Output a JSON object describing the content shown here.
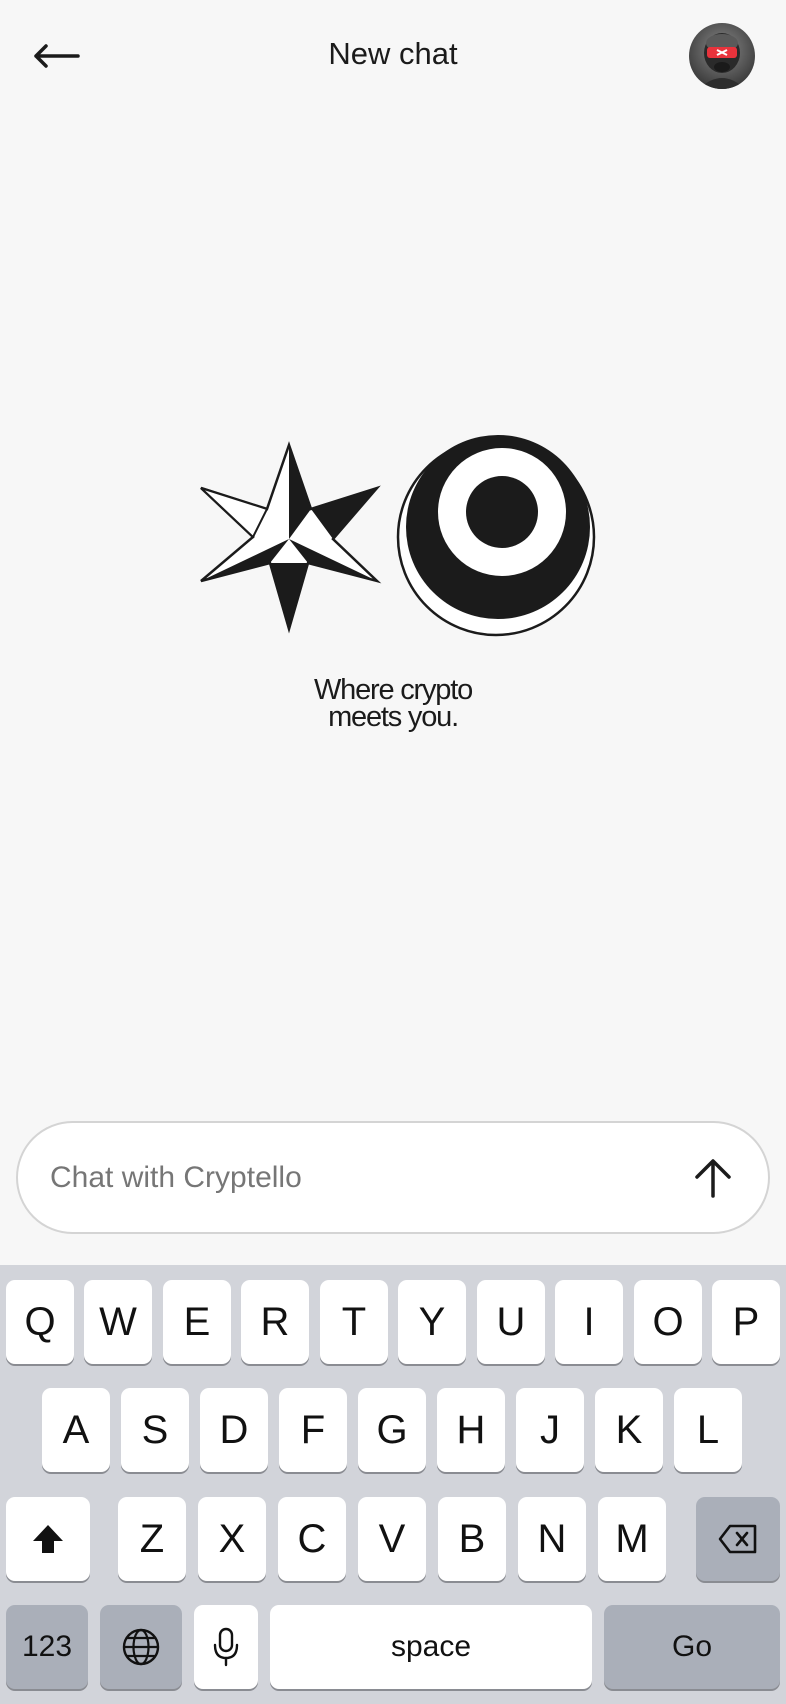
{
  "header": {
    "title": "New chat",
    "back_icon": "arrow-left-icon",
    "avatar_icon": "avatar-image"
  },
  "hero": {
    "tagline_line1": "Where crypto",
    "tagline_line2": "meets you."
  },
  "chat_input": {
    "placeholder": "Chat with Cryptello",
    "value": "",
    "send_icon": "arrow-up-icon"
  },
  "keyboard": {
    "row1": [
      "Q",
      "W",
      "E",
      "R",
      "T",
      "Y",
      "U",
      "I",
      "O",
      "P"
    ],
    "row2": [
      "A",
      "S",
      "D",
      "F",
      "G",
      "H",
      "J",
      "K",
      "L"
    ],
    "row3": [
      "Z",
      "X",
      "C",
      "V",
      "B",
      "N",
      "M"
    ],
    "numbers_label": "123",
    "space_label": "space",
    "go_label": "Go",
    "shift_icon": "shift-icon",
    "backspace_icon": "backspace-icon",
    "globe_icon": "globe-icon",
    "mic_icon": "microphone-icon"
  },
  "colors": {
    "background": "#f7f7f7",
    "ink": "#1b1b1b",
    "keyboard_bg": "#d2d4da",
    "key_light": "#ffffff",
    "key_dark": "#aaafb9",
    "avatar_accent": "#e8333c"
  }
}
